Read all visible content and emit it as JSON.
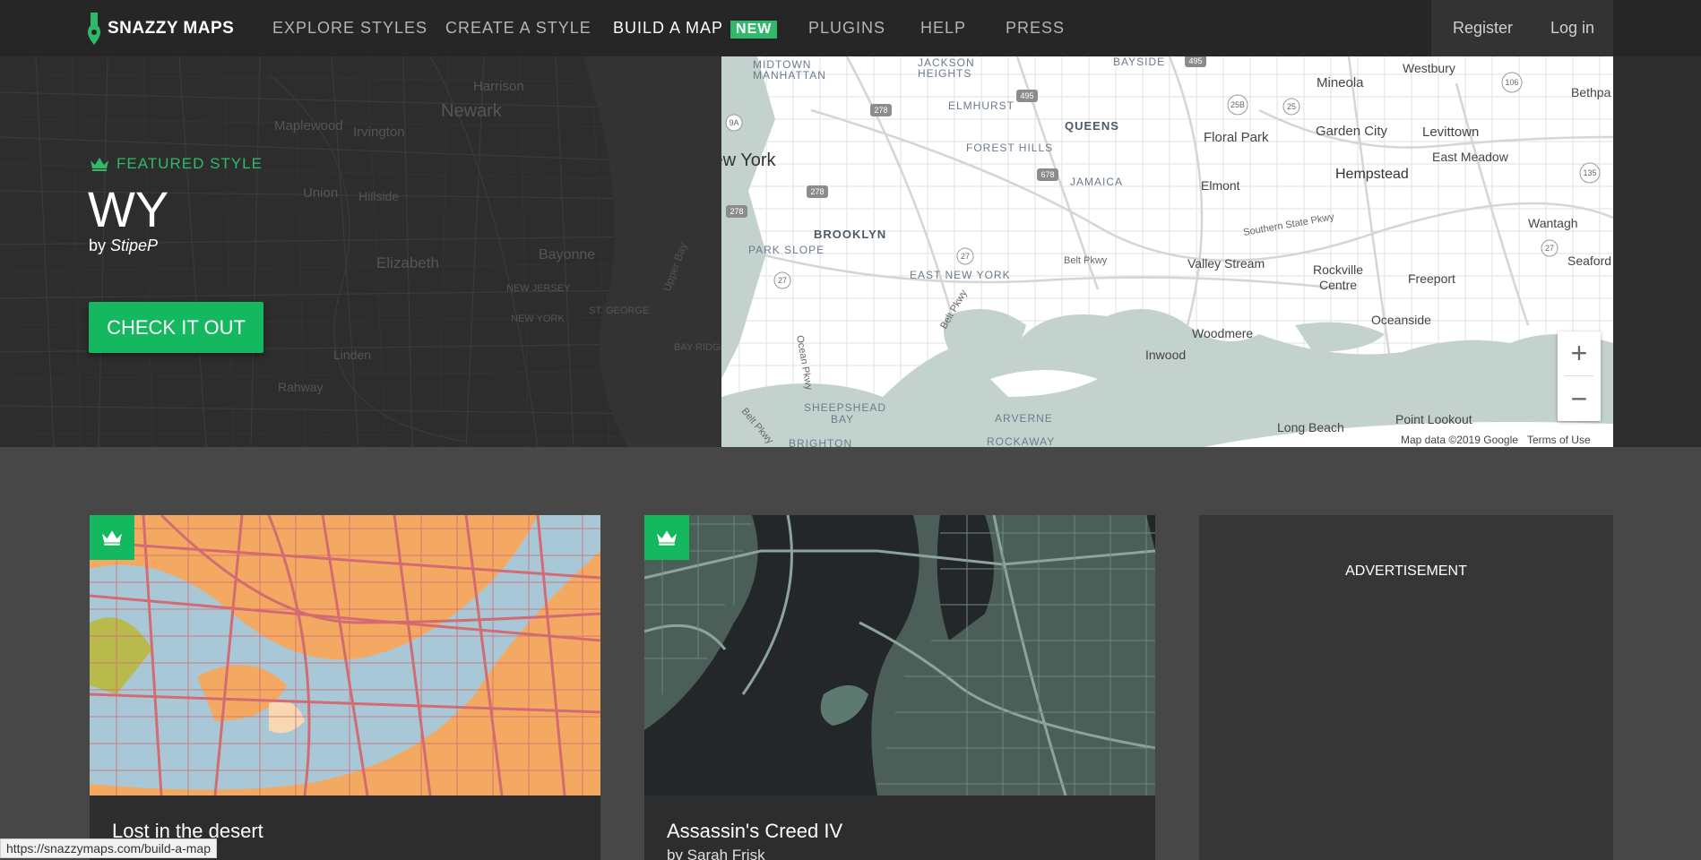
{
  "brand": {
    "name": "SNAZZY MAPS",
    "accent": "#2fba6b"
  },
  "nav": {
    "links": [
      "EXPLORE STYLES",
      "CREATE A STYLE",
      "BUILD A MAP",
      "PLUGINS",
      "HELP",
      "PRESS"
    ],
    "new_badge": "NEW",
    "register": "Register",
    "login": "Log in"
  },
  "featured": {
    "eyebrow": "FEATURED STYLE",
    "title": "WY",
    "by_prefix": "by",
    "author": "StipeP",
    "cta": "CHECK IT OUT"
  },
  "map": {
    "places_major": [
      "New York",
      "Hempstead",
      "Levittown",
      "Floral Park",
      "Garden City",
      "Mineola",
      "Westbury",
      "East Meadow",
      "Elmont",
      "Valley Stream",
      "Rockville",
      "Centre",
      "Freeport",
      "Wantagh",
      "Seaford",
      "Oceanside",
      "Woodmere",
      "Inwood",
      "Long Beach",
      "Point Lookout",
      "Bethpa"
    ],
    "places_minor": [
      "MIDTOWN",
      "MANHATTAN",
      "JACKSON",
      "HEIGHTS",
      "ELMHURST",
      "QUEENS",
      "FOREST HILLS",
      "JAMAICA",
      "BROOKLYN",
      "PARK SLOPE",
      "EAST NEW YORK",
      "SHEEPSHEAD",
      "BAY",
      "ARVERNE",
      "ROCKAWAY",
      "BRIGHTON",
      "BAYSIDE"
    ],
    "road_labels": [
      "Belt Pkwy",
      "Southern State Pkwy",
      "Ocean Pkwy",
      "Belt Pkwy",
      "Belt Pkwy"
    ],
    "shields": [
      "495",
      "495",
      "278",
      "278",
      "278",
      "678",
      "27",
      "27",
      "27",
      "25",
      "25B",
      "106",
      "135",
      "9A"
    ],
    "bg_places": [
      "Harrison",
      "Newark",
      "Irvington",
      "Maplewood",
      "Union",
      "Hillside",
      "Elizabeth",
      "Bayonne",
      "NEW JERSEY",
      "NEW YORK",
      "ST. GEORGE",
      "BAY RIDGE",
      "Upper Bay",
      "Linden",
      "Rahway"
    ],
    "zoom_in": "+",
    "zoom_out": "−",
    "attribution": "Map data ©2019 Google",
    "terms": "Terms of Use"
  },
  "cards": [
    {
      "title": "Lost in the desert",
      "author": ""
    },
    {
      "title": "Assassin's Creed IV",
      "author": "by Sarah Frisk"
    }
  ],
  "ad": {
    "label": "ADVERTISEMENT"
  },
  "status_url": "https://snazzymaps.com/build-a-map"
}
